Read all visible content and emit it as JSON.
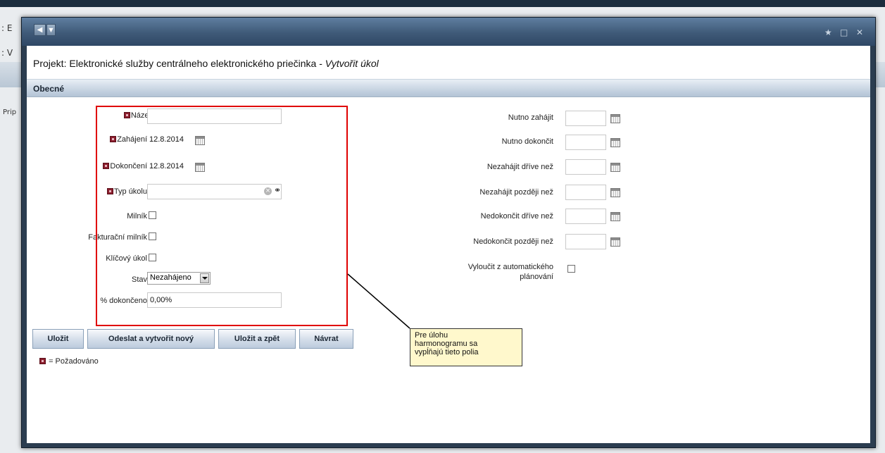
{
  "background": {
    "fragments": [
      ": E",
      ": V",
      "Prip"
    ]
  },
  "window": {
    "title": "Projekt: Elektronické služby centrálneho elektronického priečinka - ",
    "title_action": "Vytvořit úkol",
    "section": "Obecné"
  },
  "form_left": {
    "name": {
      "label": "Název",
      "value": ""
    },
    "start": {
      "label": "Zahájení",
      "value": "12.8.2014"
    },
    "finish": {
      "label": "Dokončení",
      "value": "12.8.2014"
    },
    "task_type": {
      "label": "Typ úkolu",
      "value": ""
    },
    "milestone": {
      "label": "Milník"
    },
    "billing_milestone": {
      "label": "Fakturační milník"
    },
    "key_task": {
      "label": "Klíčový úkol"
    },
    "status": {
      "label": "Stav",
      "value": "Nezahájeno"
    },
    "percent": {
      "label": "% dokončeno",
      "value": "0,00%"
    }
  },
  "form_right": {
    "must_start": "Nutno zahájit",
    "must_finish": "Nutno dokončit",
    "start_no_earlier": "Nezahájit dříve než",
    "start_no_later": "Nezahájit později než",
    "finish_no_earlier": "Nedokončit dříve než",
    "finish_no_later": "Nedokončit později než",
    "exclude_line1": "Vyloučit z automatického",
    "exclude_line2": "plánování"
  },
  "buttons": {
    "save": "Uložit",
    "send_new": "Odeslat a vytvořit nový",
    "save_back": "Uložit a zpět",
    "back": "Návrat"
  },
  "legend": "= Požadováno",
  "annotation": {
    "line1": "Pre úlohu",
    "line2": "harmonogramu sa",
    "line3": "vypĺňajú tieto polia"
  },
  "colors": {
    "highlight": "#e00000",
    "callout_bg": "#fff8cc",
    "required_marker": "#8a1d2c"
  }
}
